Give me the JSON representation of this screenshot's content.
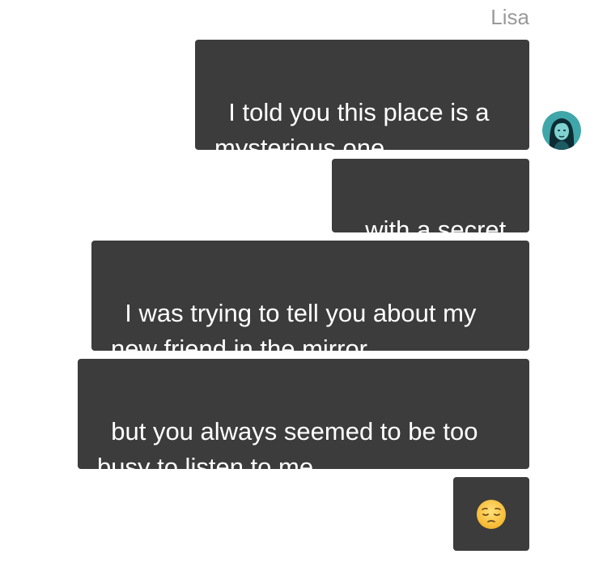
{
  "conversation": {
    "sender_name": "Lisa",
    "messages": [
      {
        "text": "I told you this place is a mysterious one"
      },
      {
        "text": "with a secret"
      },
      {
        "text": "I was trying to tell you about my new friend in the mirror"
      },
      {
        "text": "but you always seemed to be too busy to listen to me"
      },
      {
        "emoji": "pensive-face"
      }
    ],
    "avatar": {
      "icon": "woman-avatar-icon"
    }
  },
  "colors": {
    "bubble": "#3c3c3c",
    "bubble_text": "#ffffff",
    "sender_name": "#9a9a9a",
    "background": "#ffffff"
  }
}
